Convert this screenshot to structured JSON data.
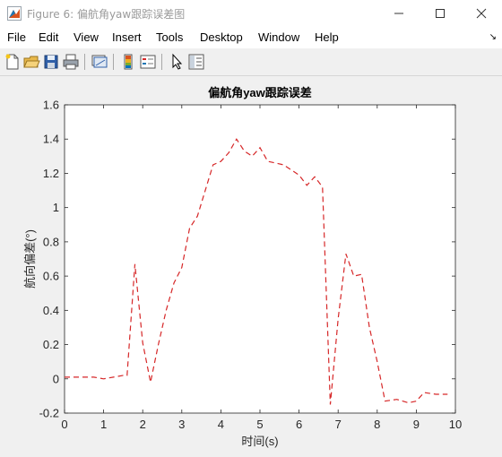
{
  "window": {
    "title": "Figure 6: 偏航角yaw跟踪误差图",
    "minimize_label": "minimize",
    "maximize_label": "maximize",
    "close_label": "close"
  },
  "menubar": {
    "items": [
      "File",
      "Edit",
      "View",
      "Insert",
      "Tools",
      "Desktop",
      "Window",
      "Help"
    ],
    "overflow_glyph": "↘"
  },
  "toolbar": {
    "buttons": [
      {
        "name": "new-figure-icon"
      },
      {
        "name": "open-file-icon"
      },
      {
        "name": "save-icon"
      },
      {
        "name": "print-icon"
      },
      {
        "name": "link-plot-icon"
      },
      {
        "name": "insert-colorbar-icon"
      },
      {
        "name": "insert-legend-icon"
      },
      {
        "name": "edit-plot-pointer-icon"
      },
      {
        "name": "property-inspector-icon"
      }
    ]
  },
  "chart_data": {
    "type": "line",
    "title": "偏航角yaw跟踪误差",
    "xlabel": "时间(s)",
    "ylabel": "航向偏差(°)",
    "xlim": [
      0,
      10
    ],
    "ylim": [
      -0.2,
      1.6
    ],
    "xticks": [
      "0",
      "1",
      "2",
      "3",
      "4",
      "5",
      "6",
      "7",
      "8",
      "9",
      "10"
    ],
    "yticks": [
      "-0.2",
      "0",
      "0.2",
      "0.4",
      "0.6",
      "0.8",
      "1",
      "1.2",
      "1.4",
      "1.6"
    ],
    "grid": false,
    "series": [
      {
        "line_style": "dashed",
        "color": "#d62728",
        "x": [
          0,
          0.25,
          0.5,
          0.75,
          1.0,
          1.25,
          1.5,
          1.6,
          1.8,
          2.0,
          2.2,
          2.4,
          2.6,
          2.8,
          3.0,
          3.2,
          3.4,
          3.6,
          3.8,
          4.0,
          4.2,
          4.4,
          4.6,
          4.8,
          5.0,
          5.2,
          5.4,
          5.6,
          5.8,
          6.0,
          6.2,
          6.4,
          6.6,
          6.8,
          7.0,
          7.2,
          7.4,
          7.6,
          7.8,
          8.0,
          8.2,
          8.5,
          8.8,
          9.0,
          9.2,
          9.5,
          9.8
        ],
        "y": [
          0.01,
          0.01,
          0.01,
          0.01,
          0.0,
          0.01,
          0.02,
          0.02,
          0.67,
          0.21,
          -0.02,
          0.2,
          0.4,
          0.56,
          0.65,
          0.88,
          0.95,
          1.1,
          1.25,
          1.27,
          1.32,
          1.4,
          1.33,
          1.3,
          1.35,
          1.27,
          1.26,
          1.25,
          1.22,
          1.19,
          1.13,
          1.18,
          1.12,
          -0.15,
          0.35,
          0.73,
          0.6,
          0.61,
          0.3,
          0.1,
          -0.13,
          -0.12,
          -0.14,
          -0.13,
          -0.08,
          -0.09,
          -0.09
        ]
      }
    ]
  }
}
